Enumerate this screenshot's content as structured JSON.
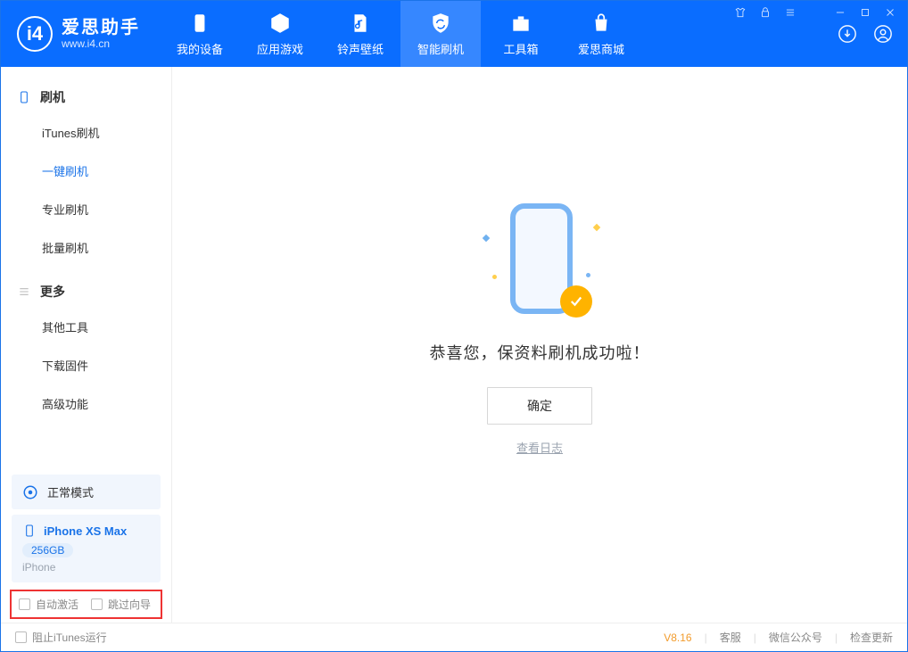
{
  "app": {
    "title": "爱思助手",
    "url": "www.i4.cn"
  },
  "nav": {
    "my_device": "我的设备",
    "apps_games": "应用游戏",
    "ring_wall": "铃声壁纸",
    "smart_flash": "智能刷机",
    "toolbox": "工具箱",
    "store": "爱思商城"
  },
  "sidebar": {
    "flash_hdr": "刷机",
    "items_flash": [
      "iTunes刷机",
      "一键刷机",
      "专业刷机",
      "批量刷机"
    ],
    "more_hdr": "更多",
    "items_more": [
      "其他工具",
      "下载固件",
      "高级功能"
    ]
  },
  "mode": {
    "label": "正常模式"
  },
  "device": {
    "name": "iPhone XS Max",
    "capacity": "256GB",
    "type": "iPhone"
  },
  "bottom_chk": {
    "auto_activate": "自动激活",
    "skip_guide": "跳过向导"
  },
  "main": {
    "success_msg": "恭喜您，保资料刷机成功啦！",
    "ok_btn": "确定",
    "log_link": "查看日志"
  },
  "footer": {
    "block_itunes": "阻止iTunes运行",
    "version": "V8.16",
    "support": "客服",
    "wechat": "微信公众号",
    "check_update": "检查更新"
  }
}
